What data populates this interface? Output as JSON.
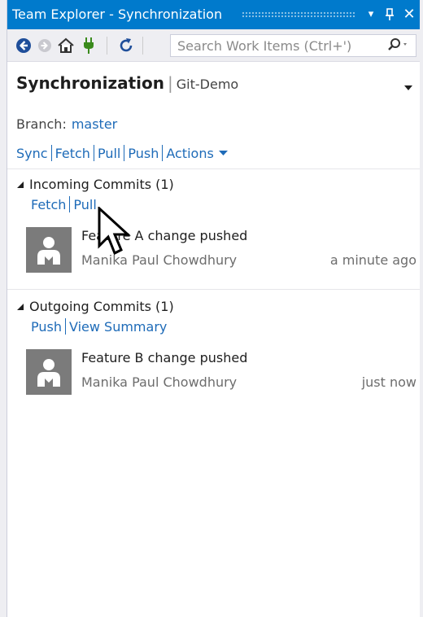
{
  "window": {
    "title": "Team Explorer - Synchronization",
    "dropdown_glyph": "▾",
    "pin_glyph": "ꟸ",
    "close_glyph": "✕"
  },
  "toolbar": {
    "icons": [
      "back-icon",
      "forward-icon",
      "home-icon",
      "connect-icon",
      "refresh-icon"
    ],
    "search_placeholder": "Search Work Items (Ctrl+')",
    "search_icon": "search-icon"
  },
  "header": {
    "title": "Synchronization",
    "separator": "|",
    "repo": "Git-Demo"
  },
  "branch": {
    "label": "Branch:",
    "value": "master"
  },
  "actions": {
    "sync": "Sync",
    "fetch": "Fetch",
    "pull": "Pull",
    "push": "Push",
    "actions": "Actions"
  },
  "incoming": {
    "title": "Incoming Commits (1)",
    "links": {
      "fetch": "Fetch",
      "pull": "Pull"
    },
    "commits": [
      {
        "message": "Feature A change pushed",
        "author": "Manika Paul Chowdhury",
        "time": "a minute ago"
      }
    ]
  },
  "outgoing": {
    "title": "Outgoing Commits (1)",
    "links": {
      "push": "Push",
      "view_summary": "View Summary"
    },
    "commits": [
      {
        "message": "Feature B change pushed",
        "author": "Manika Paul Chowdhury",
        "time": "just now"
      }
    ]
  },
  "colors": {
    "title_bar": "#007acc",
    "link": "#1e6bb8",
    "avatar": "#7b7b7b",
    "connect_icon": "#3a8a1c",
    "nav_icon": "#1f4e9a"
  }
}
